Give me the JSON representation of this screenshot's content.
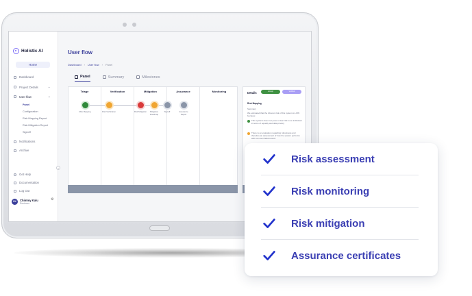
{
  "app": {
    "name": "Holistic AI",
    "home_label": "Home"
  },
  "sidebar": {
    "items": [
      {
        "label": "Dashboard"
      },
      {
        "label": "Project Details"
      },
      {
        "label": "User flow"
      },
      {
        "label": "Notifications"
      },
      {
        "label": "Archive"
      }
    ],
    "subitems": [
      {
        "label": "Panel"
      },
      {
        "label": "Configuration"
      },
      {
        "label": "Risk Mapping Report"
      },
      {
        "label": "Risk Mitigation Report"
      },
      {
        "label": "Signoff"
      }
    ],
    "footer": [
      {
        "label": "Get Help"
      },
      {
        "label": "Documentation"
      },
      {
        "label": "Log Out"
      }
    ],
    "user": {
      "initials": "CK",
      "name": "Chimmy Kalu",
      "role": "Reviewer"
    }
  },
  "main": {
    "title": "User flow",
    "breadcrumb": [
      "Dashboard",
      "User flow",
      "Panel"
    ],
    "tabs": [
      {
        "label": "Panel"
      },
      {
        "label": "Summary"
      },
      {
        "label": "Milestones"
      }
    ]
  },
  "board": {
    "columns": [
      "Triage",
      "Verification",
      "Mitigation",
      "Assurance",
      "Monitoring"
    ],
    "nodes": [
      {
        "label": "Risk Mapping",
        "color": "#2f8a3a"
      },
      {
        "label": "Risk Verification",
        "color": "#f0a531"
      },
      {
        "label": "Risk Mitigation",
        "color": "#d93a3a"
      },
      {
        "label": "Mitigation Roadmap",
        "color": "#f0a531"
      },
      {
        "label": "Signoff",
        "color": "#8a95a8"
      },
      {
        "label": "Assurance Report",
        "color": "#8a95a8"
      }
    ]
  },
  "details": {
    "title": "Details",
    "pills": [
      {
        "label": "Accept",
        "color": "#3f9142"
      },
      {
        "label": "Verified",
        "color": "#a99ef5"
      }
    ],
    "section": "Risk Mapping",
    "summary_label": "Summary",
    "summary_text": "We estimated that the inherent risk of this system is LOW because:",
    "points": [
      {
        "text": "This systems does not pose a clear risk to an individual in terms of equality and data privacy",
        "color": "#3f9142"
      },
      {
        "text": "There is an evaluation regarding robustness and therefore an assessment of how the system performs with common failures such",
        "color": "#f0a531"
      }
    ]
  },
  "features": [
    {
      "label": "Risk assessment"
    },
    {
      "label": "Risk monitoring"
    },
    {
      "label": "Risk mitigation"
    },
    {
      "label": "Assurance certificates"
    }
  ],
  "colors": {
    "accent": "#3b3fb3",
    "check": "#2233cc"
  }
}
